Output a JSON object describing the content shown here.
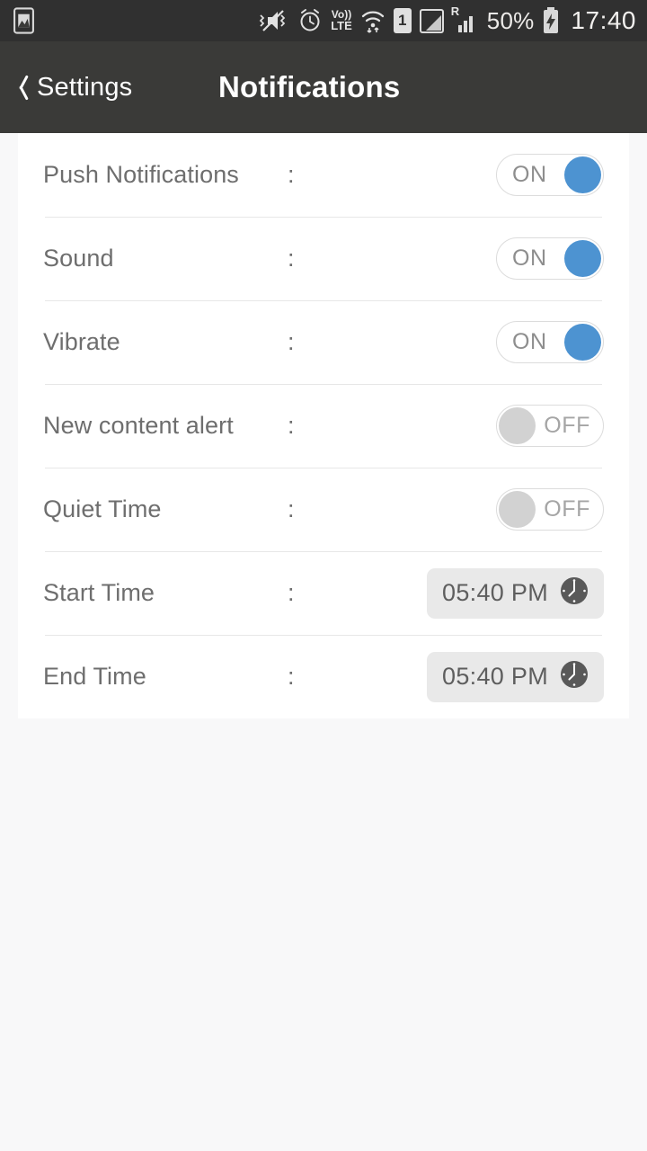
{
  "status_bar": {
    "left_icon": "image-icon",
    "icons": [
      {
        "name": "vibrate-mute-icon"
      },
      {
        "name": "alarm-clock-icon"
      },
      {
        "name": "volte-icon",
        "line1": "Vo))",
        "line2": "LTE"
      },
      {
        "name": "wifi-icon"
      },
      {
        "name": "sim-1-icon",
        "label": "1"
      },
      {
        "name": "signal-box-icon"
      },
      {
        "name": "roaming-signal-icon",
        "label": "R"
      }
    ],
    "battery_percent": "50%",
    "battery_state": "charging",
    "time": "17:40"
  },
  "nav": {
    "back_label": "Settings",
    "title": "Notifications"
  },
  "colors": {
    "accent_blue": "#4d93d1",
    "toggle_off_knob": "#d2d2d2",
    "nav_bg": "#3a3a38",
    "status_bg": "#303030",
    "page_bg": "#f8f8f9",
    "card_bg": "#ffffff",
    "label_text": "#6e6e6e",
    "divider": "#e7e7e7",
    "timefield_bg": "#e9e9e9"
  },
  "separator": ":",
  "rows": [
    {
      "label": "Push Notifications",
      "control": "toggle",
      "value": "ON",
      "state": "on"
    },
    {
      "label": "Sound",
      "control": "toggle",
      "value": "ON",
      "state": "on"
    },
    {
      "label": "Vibrate",
      "control": "toggle",
      "value": "ON",
      "state": "on"
    },
    {
      "label": "New content alert",
      "control": "toggle",
      "value": "OFF",
      "state": "off"
    },
    {
      "label": "Quiet Time",
      "control": "toggle",
      "value": "OFF",
      "state": "off"
    },
    {
      "label": "Start Time",
      "control": "time",
      "value": "05:40 PM",
      "icon": "clock-icon"
    },
    {
      "label": "End Time",
      "control": "time",
      "value": "05:40 PM",
      "icon": "clock-icon"
    }
  ]
}
